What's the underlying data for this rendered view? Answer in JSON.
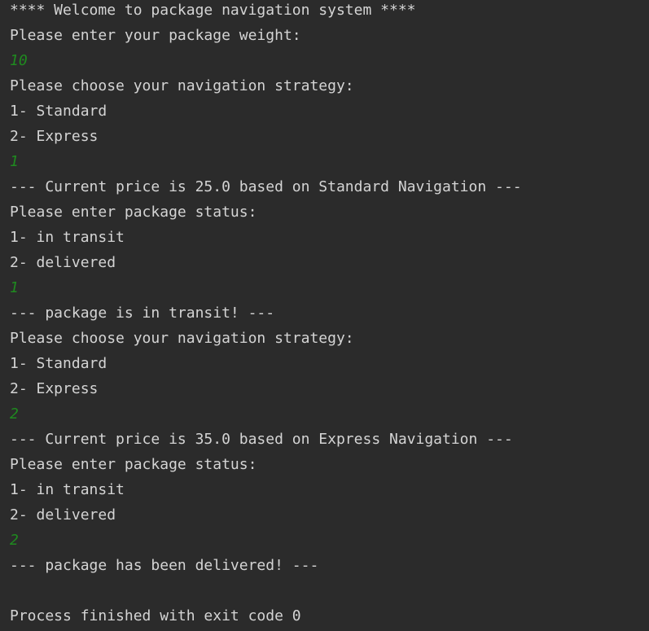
{
  "console": {
    "lines": [
      {
        "text": "**** Welcome to package navigation system ****",
        "type": "output"
      },
      {
        "text": "Please enter your package weight:",
        "type": "output"
      },
      {
        "text": "10",
        "type": "input"
      },
      {
        "text": "Please choose your navigation strategy:",
        "type": "output"
      },
      {
        "text": "1- Standard",
        "type": "output"
      },
      {
        "text": "2- Express",
        "type": "output"
      },
      {
        "text": "1",
        "type": "input"
      },
      {
        "text": "--- Current price is 25.0 based on Standard Navigation ---",
        "type": "output"
      },
      {
        "text": "Please enter package status:",
        "type": "output"
      },
      {
        "text": "1- in transit",
        "type": "output"
      },
      {
        "text": "2- delivered",
        "type": "output"
      },
      {
        "text": "1",
        "type": "input"
      },
      {
        "text": "--- package is in transit! ---",
        "type": "output"
      },
      {
        "text": "Please choose your navigation strategy:",
        "type": "output"
      },
      {
        "text": "1- Standard",
        "type": "output"
      },
      {
        "text": "2- Express",
        "type": "output"
      },
      {
        "text": "2",
        "type": "input"
      },
      {
        "text": "--- Current price is 35.0 based on Express Navigation ---",
        "type": "output"
      },
      {
        "text": "Please enter package status:",
        "type": "output"
      },
      {
        "text": "1- in transit",
        "type": "output"
      },
      {
        "text": "2- delivered",
        "type": "output"
      },
      {
        "text": "2",
        "type": "input"
      },
      {
        "text": "--- package has been delivered! ---",
        "type": "output"
      },
      {
        "text": "",
        "type": "blank"
      },
      {
        "text": "Process finished with exit code 0",
        "type": "output"
      }
    ]
  },
  "colors": {
    "background": "#2b2b2b",
    "output_text": "#d4d4d4",
    "input_text": "#1f8a1f"
  }
}
